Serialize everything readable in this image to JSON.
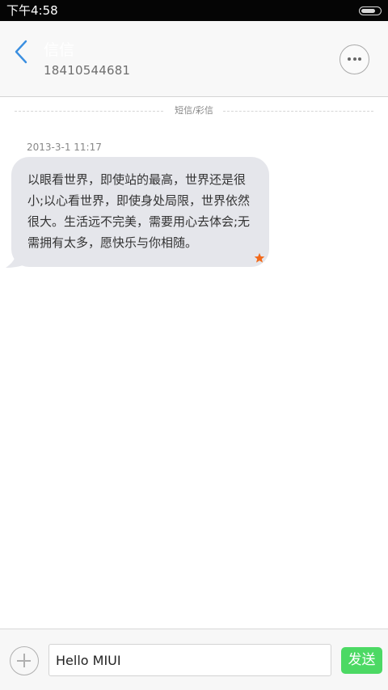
{
  "status_bar": {
    "time": "下午4:58",
    "battery_level": 0.8
  },
  "header": {
    "back_icon": "chevron-left-icon",
    "contact_name": "信信",
    "contact_number": "18410544681",
    "more_icon": "more-dots-icon"
  },
  "conversation": {
    "message_type_label": "短信/彩信",
    "messages": [
      {
        "timestamp": "2013-3-1 11:17",
        "text": "以眼看世界，即使站的最高，世界还是很小;以心看世界，即使身处局限，世界依然很大。生活远不完美，需要用心去体会;无需拥有太多，愿快乐与你相随。",
        "starred": true,
        "star_icon": "star-icon"
      }
    ]
  },
  "composer": {
    "add_icon": "plus-circle-icon",
    "input_value": "Hello MIUI",
    "send_label": "发送"
  },
  "colors": {
    "accent_blue": "#3b8fe0",
    "send_green": "#4cd964",
    "star_orange": "#f26a1b",
    "bubble_gray": "#e5e6eb"
  }
}
